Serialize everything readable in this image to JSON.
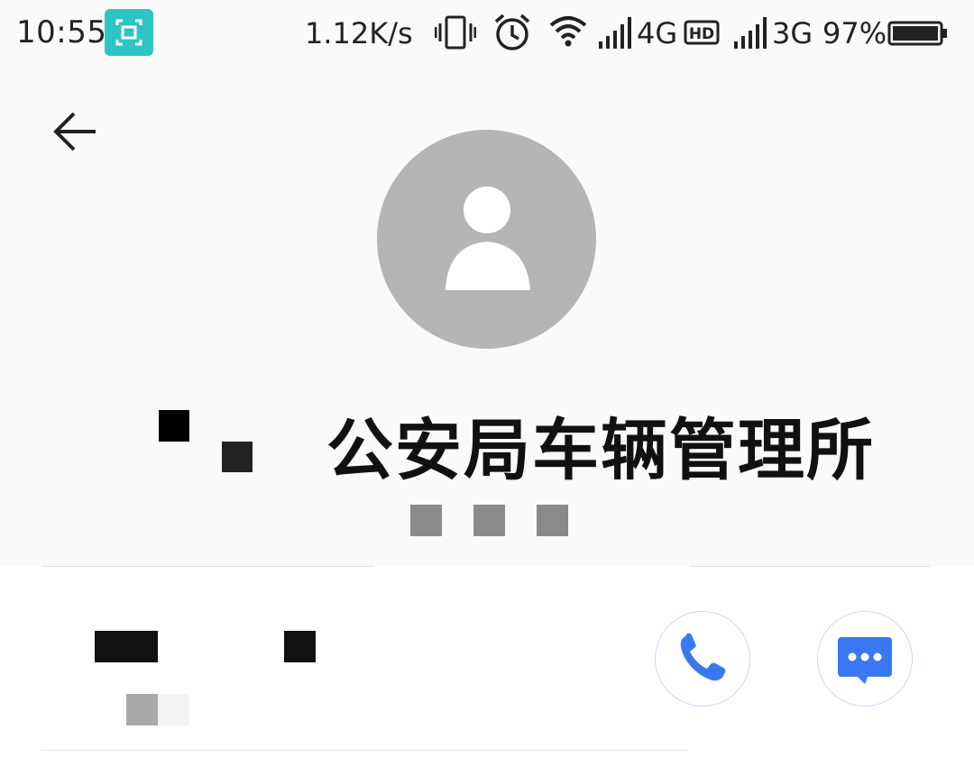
{
  "status_bar": {
    "time": "10:55",
    "network_speed": "1.12K/s",
    "sim1_type": "4G",
    "sim2_type": "3G",
    "battery_percent": "97%",
    "icons": [
      "screenshot-icon",
      "vibrate-icon",
      "alarm-icon",
      "wifi-icon",
      "signal-icon",
      "hd-icon",
      "signal-icon",
      "battery-icon"
    ]
  },
  "header": {
    "back_icon": "arrow-left-icon"
  },
  "contact": {
    "avatar_icon": "person-placeholder-icon",
    "name_visible": "公安局车辆管理所"
  },
  "actions": {
    "call_icon": "phone-icon",
    "message_icon": "message-bubble-icon"
  },
  "colors": {
    "accent_blue": "#3a78f2",
    "badge_teal": "#2ec4c6",
    "avatar_gray": "#b5b5b5"
  }
}
